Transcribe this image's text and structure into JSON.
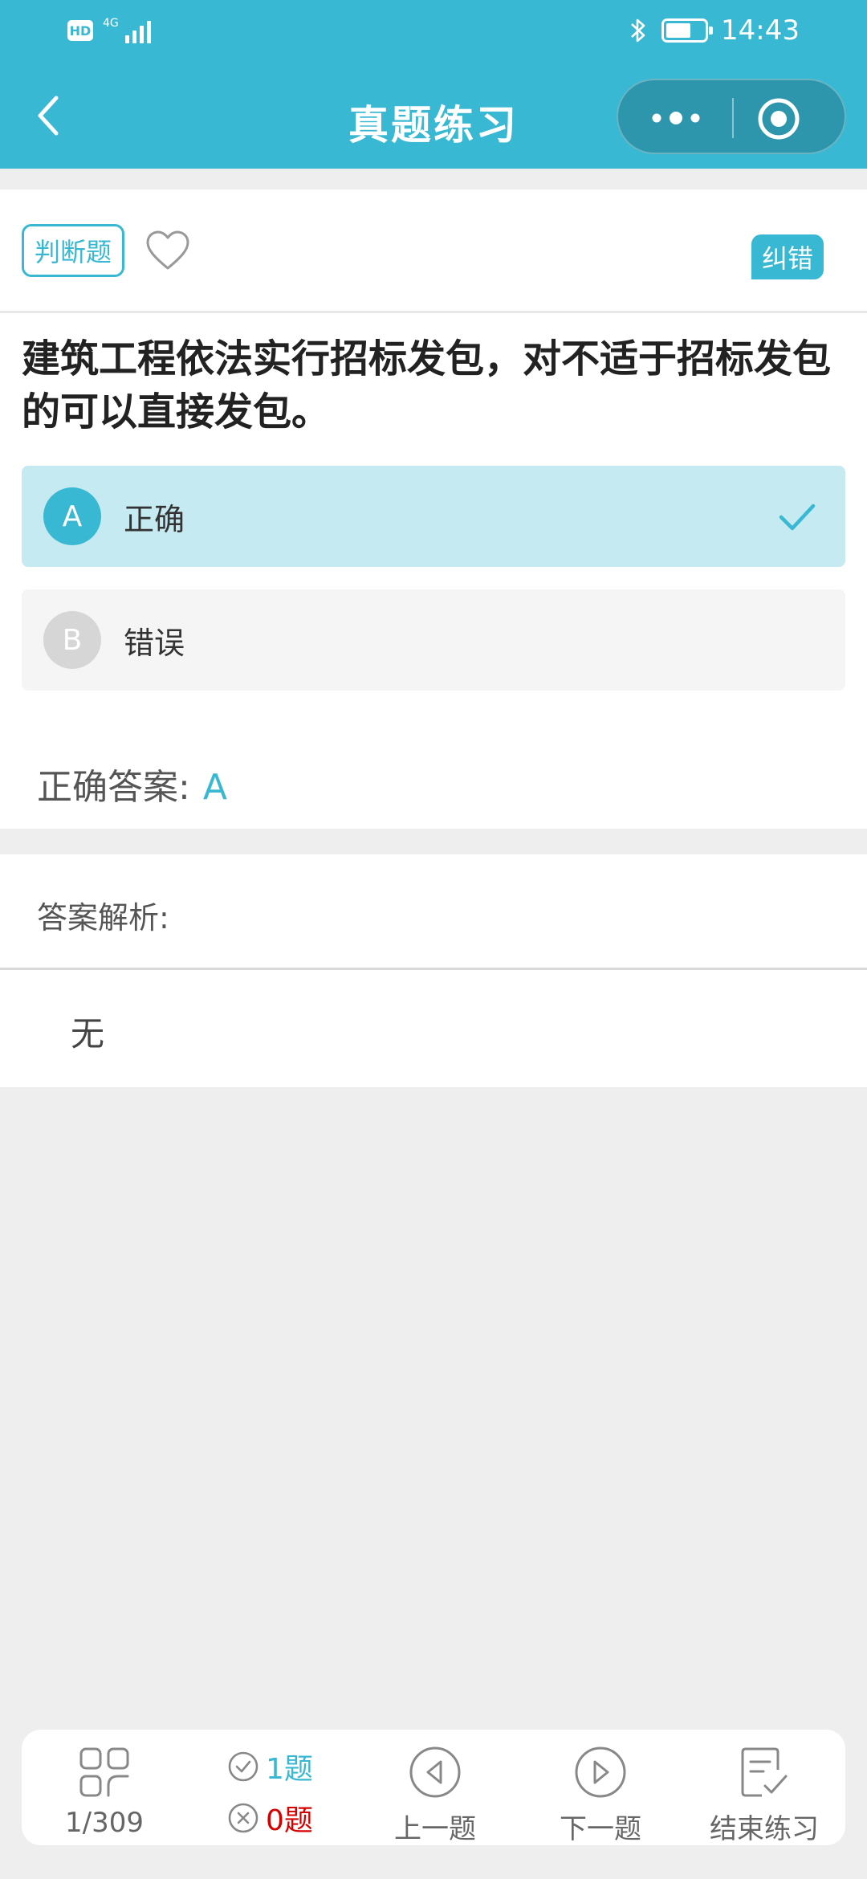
{
  "status_bar": {
    "hd": "HD",
    "network": "4G",
    "time": "14:43"
  },
  "nav": {
    "title": "真题练习"
  },
  "question": {
    "type_tag": "判断题",
    "report_label": "纠错",
    "text": "建筑工程依法实行招标发包，对不适于招标发包的可以直接发包。",
    "options": [
      {
        "letter": "A",
        "text": "正确"
      },
      {
        "letter": "B",
        "text": "错误"
      }
    ],
    "correct_answer_label": "正确答案:",
    "correct_answer_value": "A"
  },
  "analysis": {
    "label": "答案解析:",
    "text": "无"
  },
  "bottom_bar": {
    "progress": "1/309",
    "correct_count": "1题",
    "wrong_count": "0题",
    "prev_label": "上一题",
    "next_label": "下一题",
    "end_label": "结束练习"
  },
  "colors": {
    "primary": "#38b8d2",
    "error": "#d40000",
    "option_selected_bg": "#c6eaf1"
  }
}
